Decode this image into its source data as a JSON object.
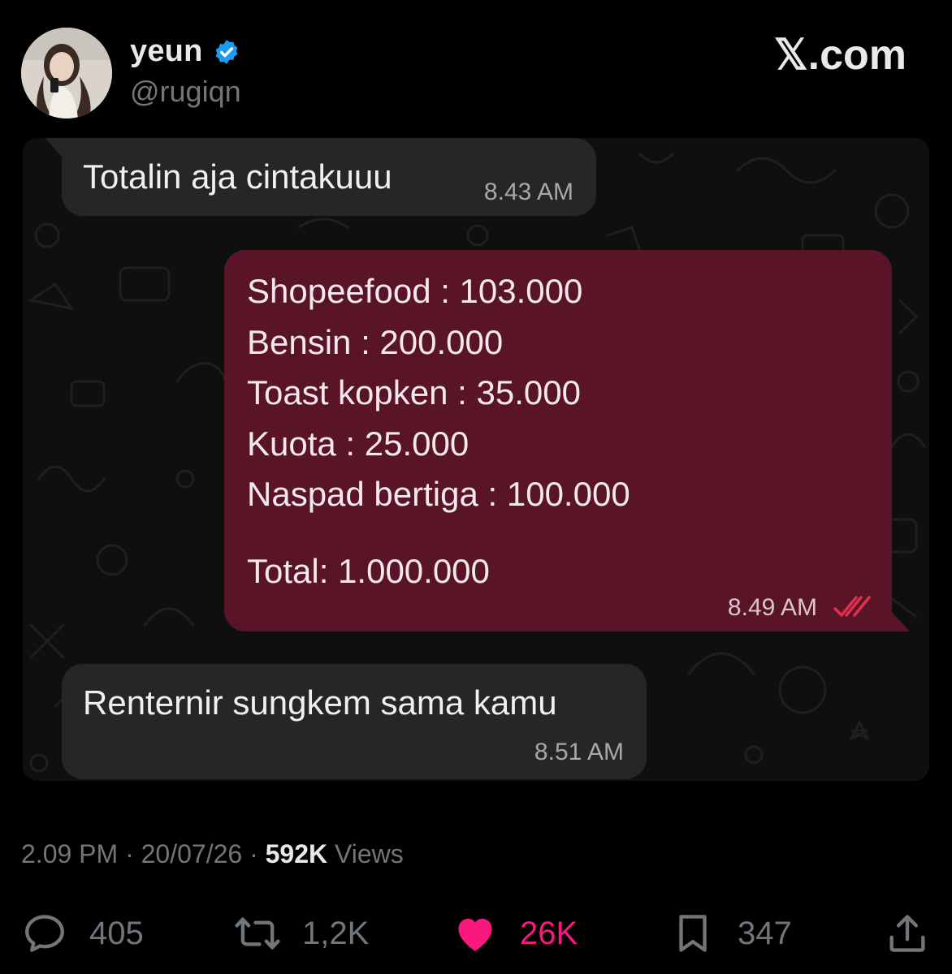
{
  "profile": {
    "name": "yeun",
    "handle": "@rugiqn",
    "site": "𝕏.com"
  },
  "chat": {
    "msg1": {
      "text": "Totalin aja cintakuuu",
      "time": "8.43 AM"
    },
    "msg2": {
      "lines": [
        "Shopeefood : 103.000",
        "Bensin : 200.000",
        "Toast kopken : 35.000",
        "Kuota : 25.000",
        "Naspad bertiga : 100.000"
      ],
      "total": "Total: 1.000.000",
      "time": "8.49 AM"
    },
    "msg3": {
      "text": "Renternir sungkem sama kamu",
      "time": "8.51 AM"
    }
  },
  "meta": {
    "time": "2.09 PM",
    "sep1": " · ",
    "date": "20/07/26",
    "sep2": " · ",
    "views": "592K",
    "views_label": " Views"
  },
  "actions": {
    "replies": "405",
    "reposts": "1,2K",
    "likes": "26K",
    "bookmarks": "347"
  },
  "colors": {
    "like": "#f91880",
    "verified": "#1d9bf0",
    "outgoing_bubble": "#5a1428",
    "incoming_bubble": "#262626"
  }
}
